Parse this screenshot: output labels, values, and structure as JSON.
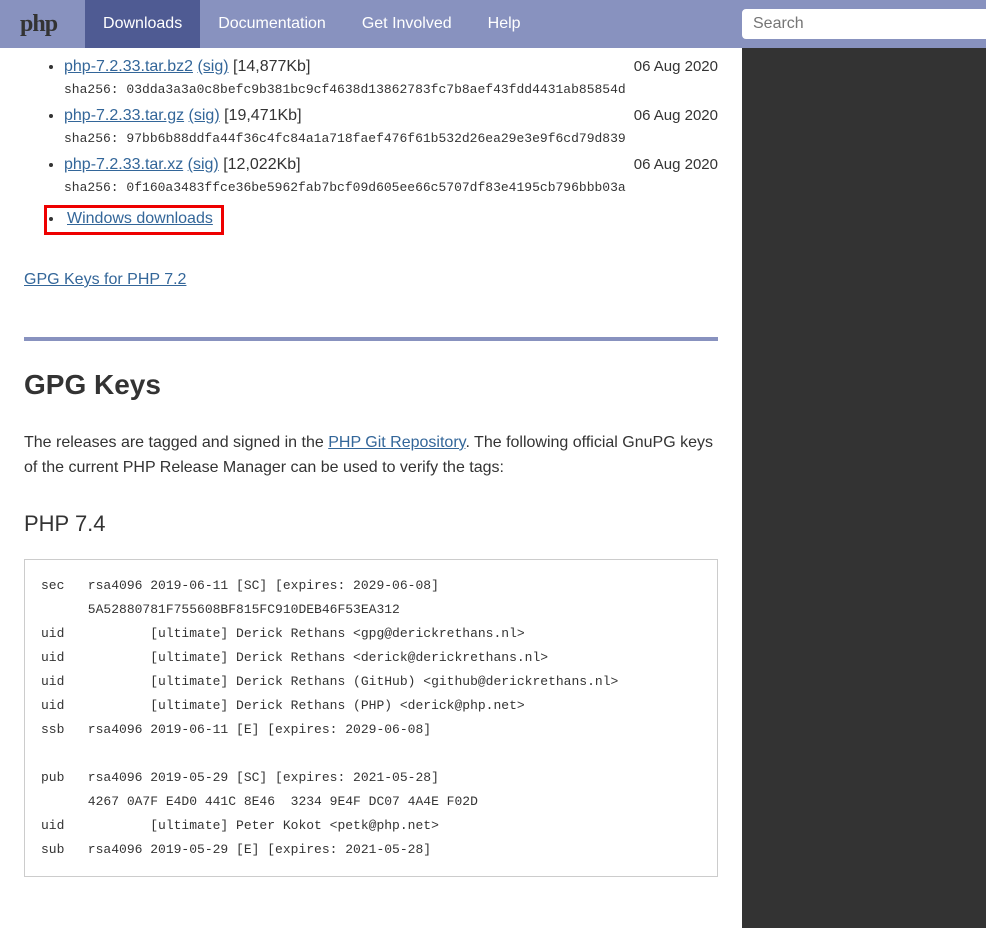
{
  "nav": {
    "logo": "php",
    "items": [
      {
        "label": "Downloads",
        "active": true
      },
      {
        "label": "Documentation",
        "active": false
      },
      {
        "label": "Get Involved",
        "active": false
      },
      {
        "label": "Help",
        "active": false
      }
    ],
    "search_placeholder": "Search"
  },
  "downloads": [
    {
      "file": "php-7.2.33.tar.bz2",
      "sig": "(sig)",
      "size": "[14,877Kb]",
      "date": "06 Aug 2020",
      "sha_label": "sha256:",
      "sha": "03dda3a3a0c8befc9b381bc9cf4638d13862783fc7b8aef43fdd4431ab85854d"
    },
    {
      "file": "php-7.2.33.tar.gz",
      "sig": "(sig)",
      "size": "[19,471Kb]",
      "date": "06 Aug 2020",
      "sha_label": "sha256:",
      "sha": "97bb6b88ddfa44f36c4fc84a1a718faef476f61b532d26ea29e3e9f6cd79d839"
    },
    {
      "file": "php-7.2.33.tar.xz",
      "sig": "(sig)",
      "size": "[12,022Kb]",
      "date": "06 Aug 2020",
      "sha_label": "sha256:",
      "sha": "0f160a3483ffce36be5962fab7bcf09d605ee66c5707df83e4195cb796bbb03a"
    }
  ],
  "windows_link": "Windows downloads",
  "gpg_keys_link": "GPG Keys for PHP 7.2",
  "section_title": "GPG Keys",
  "intro": {
    "pre": "The releases are tagged and signed in the ",
    "link": "PHP Git Repository",
    "post": ". The following official GnuPG keys of the current PHP Release Manager can be used to verify the tags:"
  },
  "sub_title": "PHP 7.4",
  "key_block": "sec   rsa4096 2019-06-11 [SC] [expires: 2029-06-08]\n      5A52880781F755608BF815FC910DEB46F53EA312\nuid           [ultimate] Derick Rethans <gpg@derickrethans.nl>\nuid           [ultimate] Derick Rethans <derick@derickrethans.nl>\nuid           [ultimate] Derick Rethans (GitHub) <github@derickrethans.nl>\nuid           [ultimate] Derick Rethans (PHP) <derick@php.net>\nssb   rsa4096 2019-06-11 [E] [expires: 2029-06-08]\n\npub   rsa4096 2019-05-29 [SC] [expires: 2021-05-28]\n      4267 0A7F E4D0 441C 8E46  3234 9E4F DC07 4A4E F02D\nuid           [ultimate] Peter Kokot <petk@php.net>\nsub   rsa4096 2019-05-29 [E] [expires: 2021-05-28]"
}
